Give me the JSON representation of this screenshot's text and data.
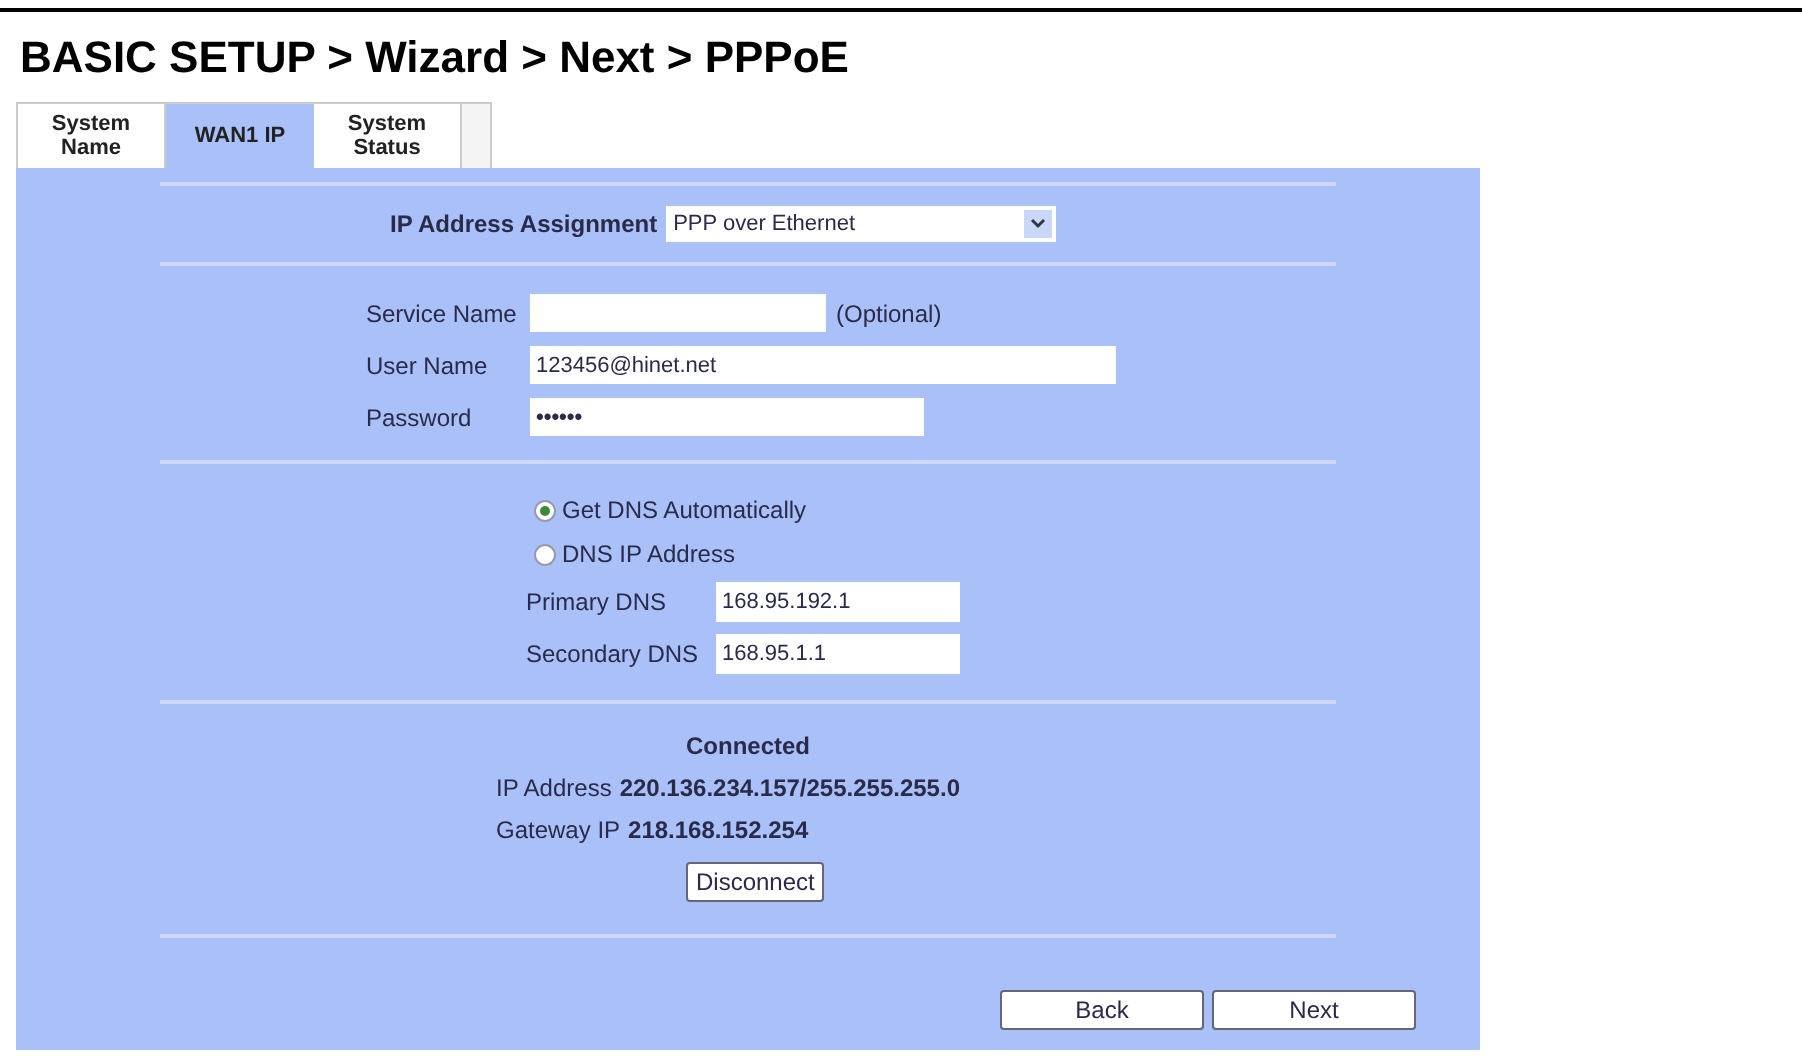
{
  "title": "BASIC SETUP > Wizard > Next > PPPoE",
  "tabs": [
    {
      "label": "System Name",
      "selected": false
    },
    {
      "label": "WAN1 IP",
      "selected": true
    },
    {
      "label": "System Status",
      "selected": false
    }
  ],
  "assignment": {
    "label": "IP Address Assignment",
    "value": "PPP over Ethernet"
  },
  "account": [
    {
      "label": "Service Name",
      "note": "(Optional)",
      "kind": "short"
    },
    {
      "label": "User Name",
      "value": "123456@hinet.net",
      "kind": "long"
    },
    {
      "label": "Password",
      "value": "••••••",
      "kind": "medium"
    }
  ],
  "dns_options": [
    {
      "label": "Get DNS Automatically",
      "selected": true
    },
    {
      "label": "DNS IP Address",
      "selected": false
    }
  ],
  "dns": [
    {
      "label": "Primary DNS",
      "value": "168.95.192.1"
    },
    {
      "label": "Secondary DNS",
      "value": "168.95.1.1"
    }
  ],
  "status": {
    "title": "Connected",
    "rows": [
      {
        "label": "IP Address",
        "value": "220.136.234.157/255.255.255.0"
      },
      {
        "label": "Gateway IP",
        "value": "218.168.152.254"
      }
    ],
    "button": "Disconnect"
  },
  "buttons": [
    "Back",
    "Next"
  ]
}
